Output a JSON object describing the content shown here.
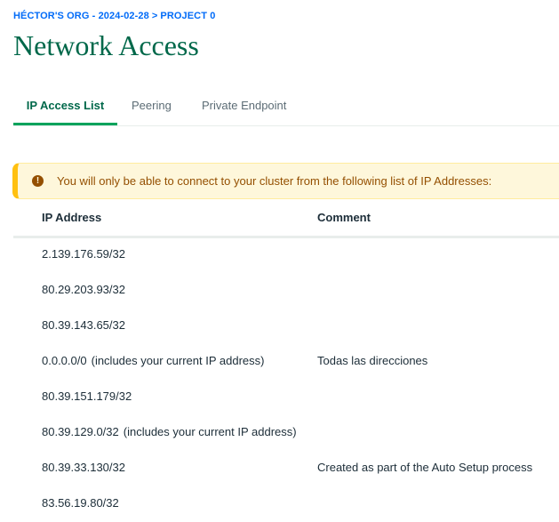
{
  "breadcrumb": {
    "org_date": "HÉCTOR'S ORG - 2024-02-28",
    "separator": ">",
    "project": "PROJECT 0"
  },
  "page_title": "Network Access",
  "tabs": [
    {
      "label": "IP Access List",
      "active": true
    },
    {
      "label": "Peering",
      "active": false
    },
    {
      "label": "Private Endpoint",
      "active": false
    }
  ],
  "banner": {
    "icon": "warning-circle-icon",
    "icon_glyph": "!",
    "text": "You will only be able to connect to your cluster from the following list of IP Addresses:"
  },
  "table": {
    "columns": [
      "IP Address",
      "Comment"
    ],
    "rows": [
      {
        "ip": "2.139.176.59/32",
        "note": "",
        "comment": ""
      },
      {
        "ip": "80.29.203.93/32",
        "note": "",
        "comment": ""
      },
      {
        "ip": "80.39.143.65/32",
        "note": "",
        "comment": ""
      },
      {
        "ip": "0.0.0.0/0",
        "note": "(includes your current IP address)",
        "comment": "Todas las direcciones"
      },
      {
        "ip": "80.39.151.179/32",
        "note": "",
        "comment": ""
      },
      {
        "ip": "80.39.129.0/32",
        "note": "(includes your current IP address)",
        "comment": ""
      },
      {
        "ip": "80.39.33.130/32",
        "note": "",
        "comment": "Created as part of the Auto Setup process"
      },
      {
        "ip": "83.56.19.80/32",
        "note": "",
        "comment": ""
      }
    ]
  },
  "colors": {
    "brand_green": "#00684a",
    "tab_underline": "#00a35c",
    "breadcrumb_blue": "#016bf8",
    "warning_bg": "#fef7db",
    "warning_border": "#ffc010",
    "warning_text": "#944f01"
  }
}
